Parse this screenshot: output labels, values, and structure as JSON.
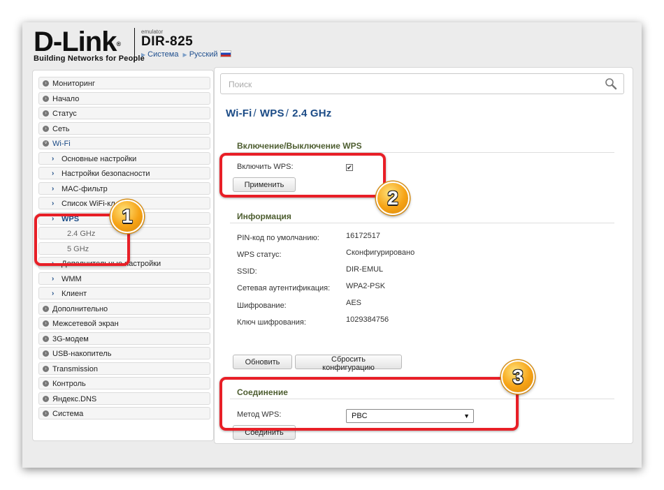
{
  "header": {
    "brand": "D-Link",
    "registered_mark": "®",
    "tagline": "Building Networks for People",
    "emulator_label": "emulator",
    "model": "DIR-825",
    "crumb_system": "Система",
    "crumb_language": "Русский",
    "flag_icon": "russian-flag-icon"
  },
  "sidebar": {
    "monitoring": "Мониторинг",
    "start": "Начало",
    "status": "Статус",
    "network": "Сеть",
    "wifi": "Wi-Fi",
    "wifi_basic": "Основные настройки",
    "wifi_security": "Настройки безопасности",
    "wifi_mac": "MAC-фильтр",
    "wifi_clients": "Список WiFi-кл",
    "wps": "WPS",
    "wps_24": "2.4 GHz",
    "wps_5": "5 GHz",
    "wifi_advanced": "Дополнительные настройки",
    "wmm": "WMM",
    "client": "Клиент",
    "advanced": "Дополнительно",
    "firewall": "Межсетевой экран",
    "modem3g": "3G-модем",
    "usb": "USB-накопитель",
    "transmission": "Transmission",
    "control": "Контроль",
    "yandex_dns": "Яндекс.DNS",
    "system": "Система"
  },
  "search": {
    "placeholder": "Поиск",
    "icon": "search-icon"
  },
  "breadcrumb": {
    "part1": "Wi-Fi",
    "part2": "WPS",
    "part3": "2.4 GHz",
    "separator": "/"
  },
  "wps_toggle": {
    "heading": "Включение/Выключение WPS",
    "enable_label": "Включить WPS:",
    "enabled_mark": "✔",
    "apply_button": "Применить"
  },
  "info": {
    "heading": "Информация",
    "pin_label": "PIN-код по умолчанию:",
    "pin_value": "16172517",
    "wps_status_label": "WPS статус:",
    "wps_status_value": "Сконфигурировано",
    "ssid_label": "SSID:",
    "ssid_value": "DIR-EMUL",
    "auth_label": "Сетевая аутентификация:",
    "auth_value": "WPA2-PSK",
    "enc_label": "Шифрование:",
    "enc_value": "AES",
    "key_label": "Ключ шифрования:",
    "key_value": "1029384756",
    "refresh_button": "Обновить",
    "reset_button": "Сбросить конфигурацию"
  },
  "connection": {
    "heading": "Соединение",
    "method_label": "Метод WPS:",
    "method_value": "PBC",
    "connect_button": "Соединить"
  },
  "annotations": {
    "badge1": "1",
    "badge2": "2",
    "badge3": "3",
    "highlight_color": "#e81f27",
    "badge_color": "#f6a316"
  }
}
